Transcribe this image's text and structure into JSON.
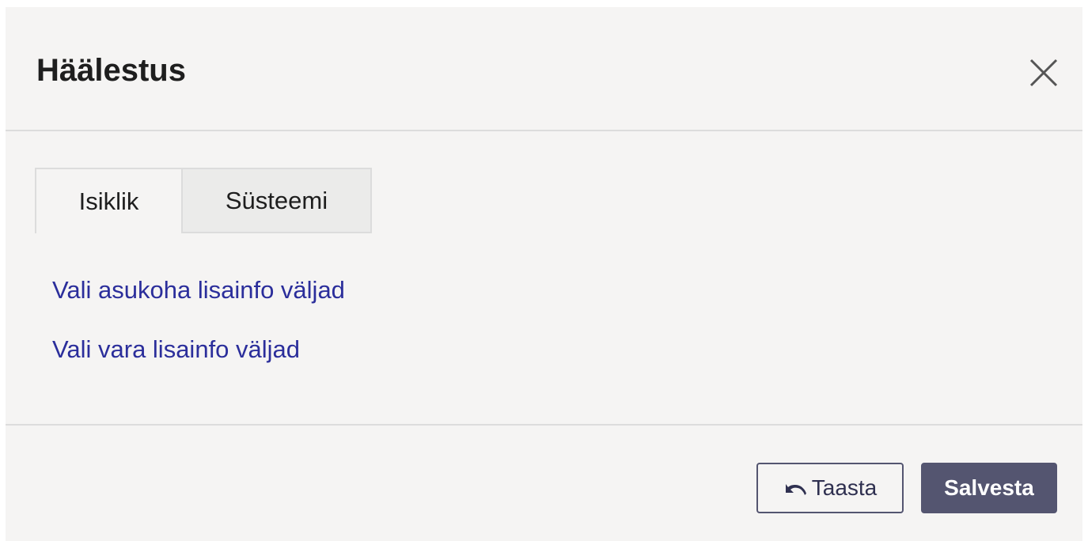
{
  "dialog": {
    "title": "Häälestus",
    "close_icon": "close-icon"
  },
  "tabs": [
    {
      "label": "Isiklik",
      "active": true
    },
    {
      "label": "Süsteemi",
      "active": false
    }
  ],
  "links": [
    {
      "label": "Vali asukoha lisainfo väljad"
    },
    {
      "label": "Vali vara lisainfo väljad"
    }
  ],
  "footer": {
    "restore_label": "Taasta",
    "restore_icon": "undo-icon",
    "save_label": "Salvesta"
  },
  "colors": {
    "background": "#f5f4f3",
    "link": "#2b2e9b",
    "primary_button": "#545570",
    "divider": "#dcdcdc"
  }
}
